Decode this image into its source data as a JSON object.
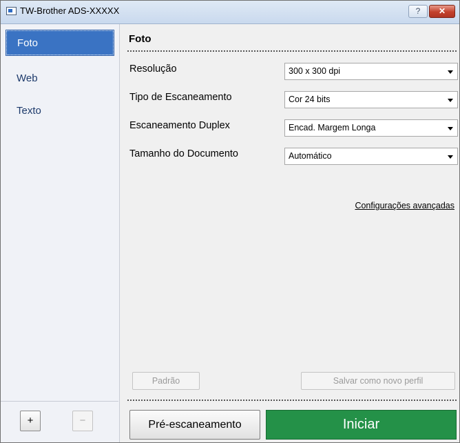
{
  "window": {
    "title": "TW-Brother ADS-XXXXX",
    "help_glyph": "?",
    "close_glyph": "✕"
  },
  "sidebar": {
    "items": [
      {
        "label": "Foto",
        "selected": true
      },
      {
        "label": "Web",
        "selected": false
      },
      {
        "label": "Texto",
        "selected": false
      }
    ],
    "add_label": "+",
    "remove_label": "−"
  },
  "main": {
    "section_title": "Foto",
    "settings": [
      {
        "label": "Resolução",
        "value": "300 x 300 dpi"
      },
      {
        "label": "Tipo de Escaneamento",
        "value": "Cor 24 bits"
      },
      {
        "label": "Escaneamento Duplex",
        "value": "Encad. Margem Longa"
      },
      {
        "label": "Tamanho do Documento",
        "value": "Automático"
      }
    ],
    "advanced_link": "Configurações avançadas",
    "default_button": "Padrão",
    "save_profile_button": "Salvar como novo perfil",
    "prescan_button": "Pré-escaneamento",
    "start_button": "Iniciar"
  },
  "colors": {
    "selected_item": "#3a73c3",
    "start_button": "#249148",
    "close_button": "#c3412c"
  }
}
